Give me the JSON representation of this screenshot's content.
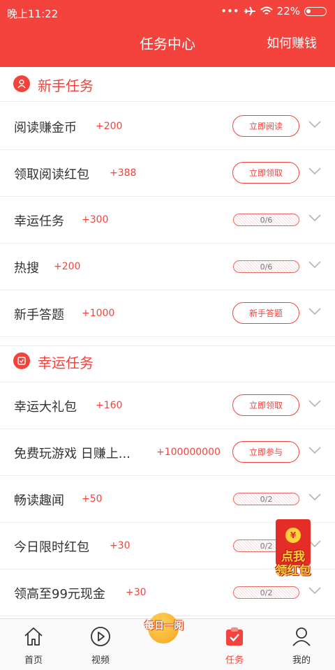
{
  "status_bar": {
    "time": "晚上11:22",
    "battery": "22%"
  },
  "header": {
    "title": "任务中心",
    "right_link": "如何赚钱"
  },
  "sections": [
    {
      "title": "新手任务",
      "tasks": [
        {
          "name": "阅读赚金币",
          "reward": "+200",
          "action": "立即阅读",
          "type": "button"
        },
        {
          "name": "领取阅读红包",
          "reward": "+388",
          "action": "立即领取",
          "type": "button"
        },
        {
          "name": "幸运任务",
          "reward": "+300",
          "action": "0/6",
          "type": "progress"
        },
        {
          "name": "热搜",
          "reward": "+200",
          "action": "0/6",
          "type": "progress"
        },
        {
          "name": "新手答题",
          "reward": "+1000",
          "action": "新手答题",
          "type": "button"
        }
      ]
    },
    {
      "title": "幸运任务",
      "tasks": [
        {
          "name": "幸运大礼包",
          "reward": "+160",
          "action": "立即领取",
          "type": "button"
        },
        {
          "name": "免费玩游戏  日赚上...",
          "reward": "+100000000",
          "action": "立即参与",
          "type": "button"
        },
        {
          "name": "畅读趣闻",
          "reward": "+50",
          "action": "0/2",
          "type": "progress"
        },
        {
          "name": "今日限时红包",
          "reward": "+30",
          "action": "0/2",
          "type": "progress"
        },
        {
          "name": "领高至99元现金",
          "reward": "+30",
          "action": "0/2",
          "type": "progress"
        }
      ]
    }
  ],
  "floating_ad": {
    "coin": "¥",
    "line1": "点我",
    "line2": "领红包"
  },
  "center_badge": "每日一阅",
  "tabs": [
    {
      "label": "首页",
      "icon": "home-icon"
    },
    {
      "label": "视频",
      "icon": "play-icon"
    },
    {
      "label": "",
      "icon": "daily-read-icon"
    },
    {
      "label": "任务",
      "icon": "task-icon",
      "active": true
    },
    {
      "label": "我的",
      "icon": "profile-icon"
    }
  ],
  "colors": {
    "accent": "#f4433c"
  }
}
